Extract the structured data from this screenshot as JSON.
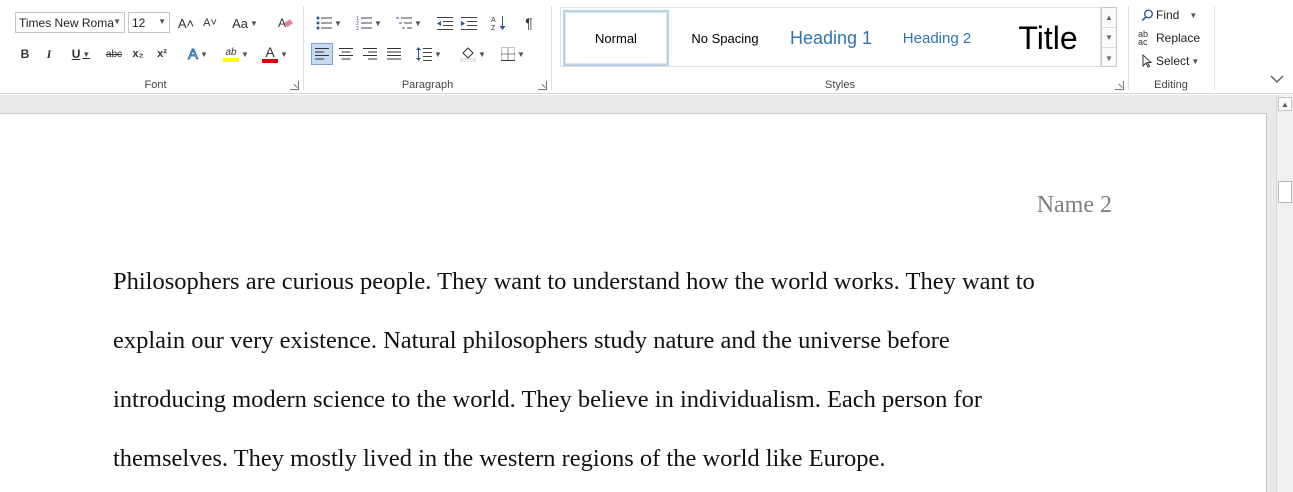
{
  "ribbon": {
    "font": {
      "label": "Font",
      "font_name": "Times New Roma",
      "font_size": "12",
      "grow_icon": "A˄",
      "shrink_icon": "A˅",
      "change_case": "Aa",
      "bold": "B",
      "italic": "I",
      "underline": "U",
      "strike": "abc",
      "subscript": "x₂",
      "superscript": "x²",
      "text_effects": "A",
      "highlight": "ab",
      "font_color": "A"
    },
    "paragraph": {
      "label": "Paragraph",
      "pilcrow": "¶"
    },
    "styles": {
      "label": "Styles",
      "items": [
        "Normal",
        "No Spacing",
        "Heading 1",
        "Heading 2",
        "Title"
      ]
    },
    "editing": {
      "label": "Editing",
      "find": "Find",
      "replace": "Replace",
      "select": "Select"
    }
  },
  "colors": {
    "heading_blue": "#2e74b5",
    "highlight_yellow": "#ffff00",
    "font_red": "#e00000",
    "selected_bg": "#c5d9f1"
  },
  "document": {
    "header_text": "Name 2",
    "lines": [
      "Philosophers are curious people. They want to understand how the world works. They want to",
      "explain our very existence. Natural philosophers study nature and the universe before",
      "introducing modern science to the world. They believe in individualism. Each person for",
      "themselves. They mostly lived in the western regions of the world like Europe."
    ]
  }
}
